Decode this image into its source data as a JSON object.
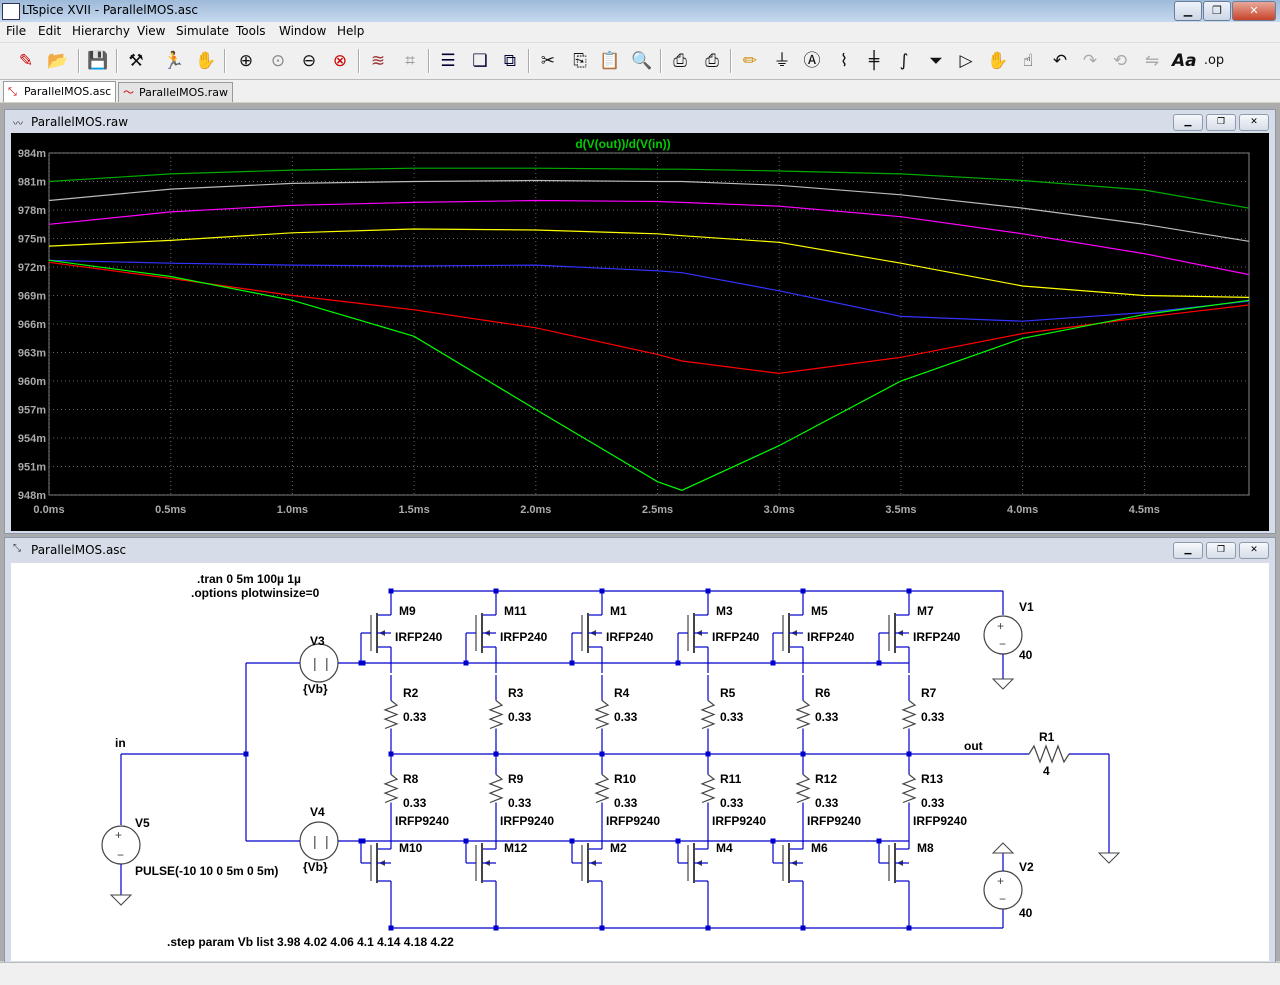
{
  "window": {
    "title": "LTspice XVII - ParallelMOS.asc"
  },
  "menu": [
    "File",
    "Edit",
    "Hierarchy",
    "View",
    "Simulate",
    "Tools",
    "Window",
    "Help"
  ],
  "tabs": [
    {
      "label": "ParallelMOS.asc",
      "active": true
    },
    {
      "label": "ParallelMOS.raw",
      "active": false
    }
  ],
  "plot_window": {
    "title": "ParallelMOS.raw"
  },
  "schematic_window": {
    "title": "ParallelMOS.asc"
  },
  "chart_data": {
    "type": "line",
    "title": "d(V(out))/d(V(in))",
    "xlabel": "",
    "ylabel": "",
    "xlim": [
      0,
      4.93
    ],
    "ylim": [
      948,
      984
    ],
    "x_ticks": [
      "0.0ms",
      "0.5ms",
      "1.0ms",
      "1.5ms",
      "2.0ms",
      "2.5ms",
      "3.0ms",
      "3.5ms",
      "4.0ms",
      "4.5ms"
    ],
    "x_tick_values": [
      0,
      0.5,
      1.0,
      1.5,
      2.0,
      2.5,
      3.0,
      3.5,
      4.0,
      4.5
    ],
    "y_ticks": [
      "984m",
      "981m",
      "978m",
      "975m",
      "972m",
      "969m",
      "966m",
      "963m",
      "960m",
      "957m",
      "954m",
      "951m",
      "948m"
    ],
    "y_tick_values": [
      984,
      981,
      978,
      975,
      972,
      969,
      966,
      963,
      960,
      957,
      954,
      951,
      948
    ],
    "grid": true,
    "x": [
      0,
      0.5,
      1.0,
      1.5,
      2.0,
      2.5,
      2.6,
      3.0,
      3.5,
      4.0,
      4.5,
      4.93
    ],
    "series": [
      {
        "color": "#00aa00",
        "values": [
          981.0,
          981.8,
          982.2,
          982.4,
          982.4,
          982.3,
          982.3,
          982.1,
          981.8,
          981.1,
          980.1,
          978.2
        ]
      },
      {
        "color": "#bbbbbb",
        "values": [
          979.0,
          980.2,
          980.8,
          981.0,
          981.1,
          981.0,
          981.0,
          980.6,
          979.6,
          978.2,
          976.5,
          974.7
        ]
      },
      {
        "color": "#ff00ff",
        "values": [
          976.5,
          977.8,
          978.5,
          978.8,
          979.0,
          978.9,
          978.8,
          978.4,
          977.3,
          975.5,
          973.4,
          971.2
        ]
      },
      {
        "color": "#ffff00",
        "values": [
          974.2,
          974.8,
          975.6,
          976.0,
          975.9,
          975.5,
          975.3,
          974.6,
          972.4,
          970.0,
          969.0,
          968.8
        ]
      },
      {
        "color": "#3333ff",
        "values": [
          972.7,
          972.4,
          972.2,
          972.1,
          972.2,
          971.6,
          971.4,
          969.5,
          966.8,
          966.3,
          967.2,
          968.4
        ]
      },
      {
        "color": "#ff0000",
        "values": [
          972.5,
          970.8,
          969.0,
          967.5,
          965.6,
          962.8,
          962.1,
          960.8,
          962.5,
          965.0,
          966.7,
          968.0
        ]
      },
      {
        "color": "#00ff00",
        "values": [
          972.7,
          971.0,
          968.5,
          964.7,
          957.0,
          949.4,
          948.5,
          953.2,
          960.0,
          964.5,
          967.0,
          968.5
        ]
      }
    ]
  },
  "schematic": {
    "directives": [
      ".tran 0 5m 100µ 1µ",
      ".options plotwinsize=0"
    ],
    "step": ".step param Vb list 3.98 4.02 4.06 4.1 4.14 4.18 4.22",
    "top_fets": [
      {
        "name": "M9",
        "model": "IRFP240"
      },
      {
        "name": "M11",
        "model": "IRFP240"
      },
      {
        "name": "M1",
        "model": "IRFP240"
      },
      {
        "name": "M3",
        "model": "IRFP240"
      },
      {
        "name": "M5",
        "model": "IRFP240"
      },
      {
        "name": "M7",
        "model": "IRFP240"
      }
    ],
    "bottom_fets": [
      {
        "name": "M10",
        "model": "IRFP9240"
      },
      {
        "name": "M12",
        "model": "IRFP9240"
      },
      {
        "name": "M2",
        "model": "IRFP9240"
      },
      {
        "name": "M4",
        "model": "IRFP9240"
      },
      {
        "name": "M6",
        "model": "IRFP9240"
      },
      {
        "name": "M8",
        "model": "IRFP9240"
      }
    ],
    "top_res": [
      {
        "name": "R2",
        "value": "0.33"
      },
      {
        "name": "R3",
        "value": "0.33"
      },
      {
        "name": "R4",
        "value": "0.33"
      },
      {
        "name": "R5",
        "value": "0.33"
      },
      {
        "name": "R6",
        "value": "0.33"
      },
      {
        "name": "R7",
        "value": "0.33"
      }
    ],
    "bottom_res": [
      {
        "name": "R8",
        "value": "0.33"
      },
      {
        "name": "R9",
        "value": "0.33"
      },
      {
        "name": "R10",
        "value": "0.33"
      },
      {
        "name": "R11",
        "value": "0.33"
      },
      {
        "name": "R12",
        "value": "0.33"
      },
      {
        "name": "R13",
        "value": "0.33"
      }
    ],
    "V1": {
      "name": "V1",
      "value": "40"
    },
    "V2": {
      "name": "V2",
      "value": "40"
    },
    "V3": {
      "name": "V3",
      "value": "{Vb}"
    },
    "V4": {
      "name": "V4",
      "value": "{Vb}"
    },
    "V5": {
      "name": "V5",
      "value": "PULSE(-10 10 0 5m 0 5m)"
    },
    "R1": {
      "name": "R1",
      "value": "4"
    },
    "labels": {
      "in": "in",
      "out": "out"
    }
  }
}
